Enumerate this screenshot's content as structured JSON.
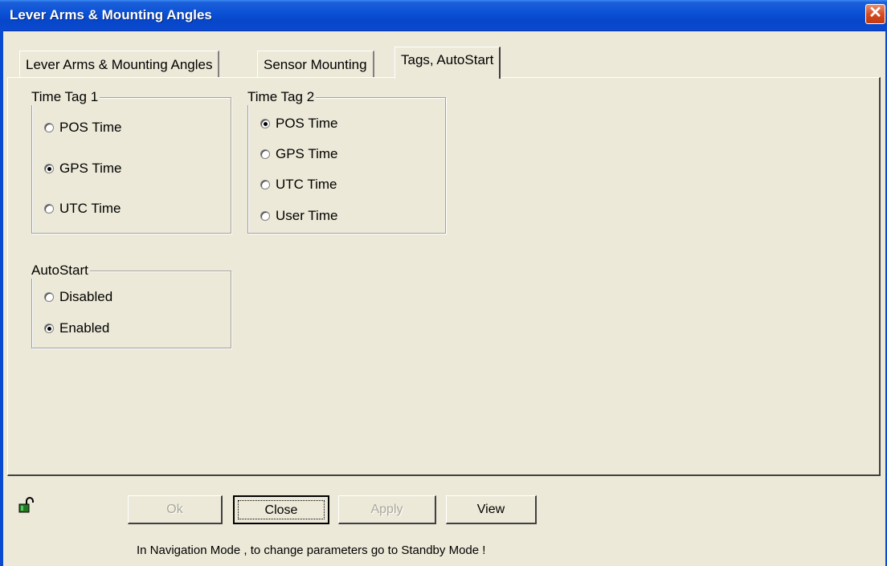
{
  "window": {
    "title": "Lever Arms & Mounting Angles",
    "close_glyph": "✕"
  },
  "tabs": [
    {
      "label": "Lever Arms & Mounting Angles",
      "active": false
    },
    {
      "label": "Sensor Mounting",
      "active": false
    },
    {
      "label": "Tags, AutoStart",
      "active": true
    }
  ],
  "time_tag_1": {
    "title": "Time Tag 1",
    "options": [
      {
        "label": "POS Time",
        "selected": false
      },
      {
        "label": "GPS Time",
        "selected": true
      },
      {
        "label": "UTC Time",
        "selected": false
      }
    ]
  },
  "time_tag_2": {
    "title": "Time Tag 2",
    "options": [
      {
        "label": "POS Time",
        "selected": true
      },
      {
        "label": "GPS Time",
        "selected": false
      },
      {
        "label": "UTC Time",
        "selected": false
      },
      {
        "label": "User Time",
        "selected": false
      }
    ]
  },
  "autostart": {
    "title": "AutoStart",
    "options": [
      {
        "label": "Disabled",
        "selected": false
      },
      {
        "label": "Enabled",
        "selected": true
      }
    ]
  },
  "buttons": {
    "ok": "Ok",
    "close": "Close",
    "apply": "Apply",
    "view": "View"
  },
  "status_message": "In Navigation Mode , to change parameters go to Standby Mode !",
  "icons": {
    "lock": "lock-icon"
  }
}
